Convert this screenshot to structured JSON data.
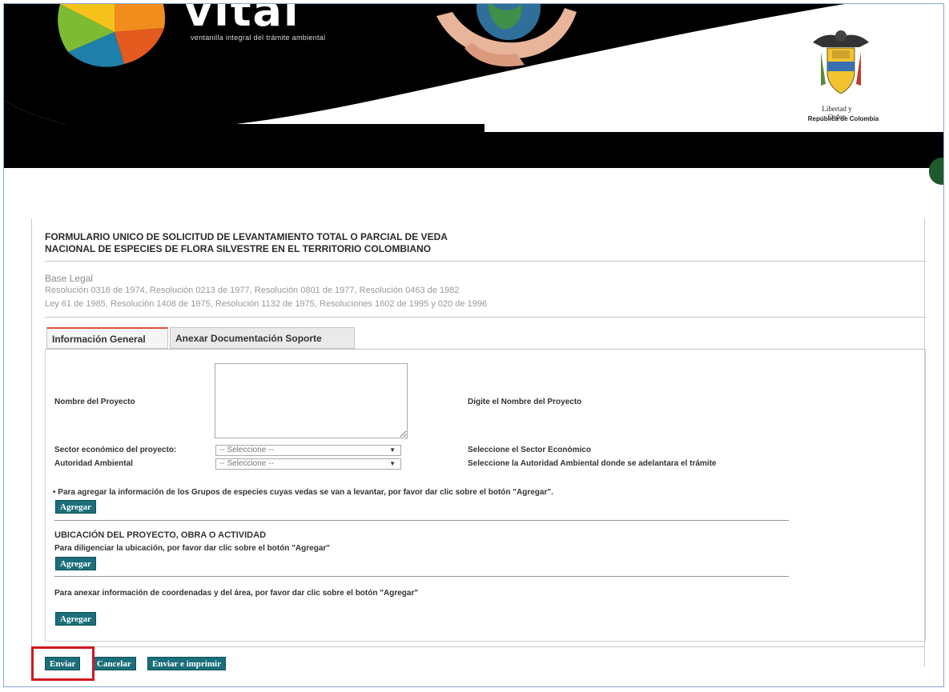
{
  "header": {
    "logo_text": "vital",
    "logo_tagline": "ventanilla integral del trámite ambiental",
    "crest_motto": "Libertad y Orden",
    "crest_country": "República de Colombia"
  },
  "form": {
    "title_line1": "FORMULARIO UNICO DE SOLICITUD DE LEVANTAMIENTO TOTAL O PARCIAL DE VEDA",
    "title_line2": "NACIONAL DE ESPECIES DE FLORA SILVESTRE EN EL TERRITORIO COLOMBIANO",
    "legal_heading": "Base Legal",
    "legal_line1": "Resolución 0316 de 1974, Resolución 0213 de 1977, Resolución 0801 de 1977, Resolución 0463 de 1982",
    "legal_line2": "Ley 61 de 1985, Resolución 1408 de 1975, Resolución 1132 de 1975, Resoluciones 1602 de 1995 y 020 de 1996"
  },
  "tabs": [
    {
      "label": "Información General",
      "active": true
    },
    {
      "label": "Anexar Documentación Soporte",
      "active": false
    }
  ],
  "fields": {
    "project_name_label": "Nombre del Proyecto",
    "project_name_value": "",
    "project_name_help": "Digite el Nombre del Proyecto",
    "sector_label": "Sector económico del proyecto:",
    "sector_value": "-- Seleccione --",
    "sector_help": "Seleccione el Sector Económico",
    "authority_label": "Autoridad Ambiental",
    "authority_value": "-- Seleccione --",
    "authority_help": "Seleccione la Autoridad Ambiental donde se adelantara el trámite"
  },
  "sections": {
    "species_note": "• Para agregar la información de los Grupos de especies cuyas vedas se van a levantar, por favor dar clic sobre el botón \"Agregar\".",
    "location_title": "UBICACIÓN DEL PROYECTO, OBRA O ACTIVIDAD",
    "location_note": "Para diligenciar la ubicación, por favor dar clic sobre el botón \"Agregar\"",
    "coordinates_note": "Para anexar información de coordenadas y del área, por favor dar clic sobre el botón \"Agregar\"",
    "add_label": "Agregar"
  },
  "actions": {
    "send": "Enviar",
    "cancel": "Cancelar",
    "send_print": "Enviar e imprimir"
  },
  "colors": {
    "button_bg": "#1b6f7a",
    "tab_accent": "#d9513b",
    "highlight": "#d0181f",
    "banner_black": "#000000"
  }
}
